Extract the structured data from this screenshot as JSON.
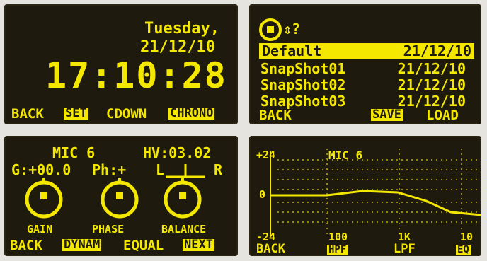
{
  "panel_clock": {
    "day": "Tuesday,",
    "date": "21/12/10",
    "time": "17:10:28",
    "buttons": [
      "BACK",
      "SET",
      "CDOWN",
      "CHRONO"
    ]
  },
  "panel_snapshots": {
    "prompt": "⇕?",
    "rows": [
      {
        "name": "Default",
        "date": "21/12/10"
      },
      {
        "name": "SnapShot01",
        "date": "21/12/10"
      },
      {
        "name": "SnapShot02",
        "date": "21/12/10"
      },
      {
        "name": "SnapShot03",
        "date": "21/12/10"
      }
    ],
    "buttons": [
      "BACK",
      "SAVE",
      "LOAD"
    ]
  },
  "panel_mic": {
    "title": "MIC 6",
    "hv": "HV:03.02",
    "gain": "G:+00.0",
    "phase": "Ph:+",
    "balance_left": "L",
    "balance_right": "R",
    "knob_labels": [
      "GAIN",
      "PHASE",
      "BALANCE"
    ],
    "buttons": [
      "BACK",
      "DYNAM",
      "EQUAL",
      "NEXT"
    ]
  },
  "panel_eq": {
    "title": "MIC 6",
    "top_label": "+24",
    "zero_label": "0",
    "bottom_label": "-24",
    "freq_labels": [
      "100",
      "1K",
      "10"
    ],
    "buttons": [
      "BACK",
      "HPF",
      "LPF",
      "EQ"
    ]
  }
}
